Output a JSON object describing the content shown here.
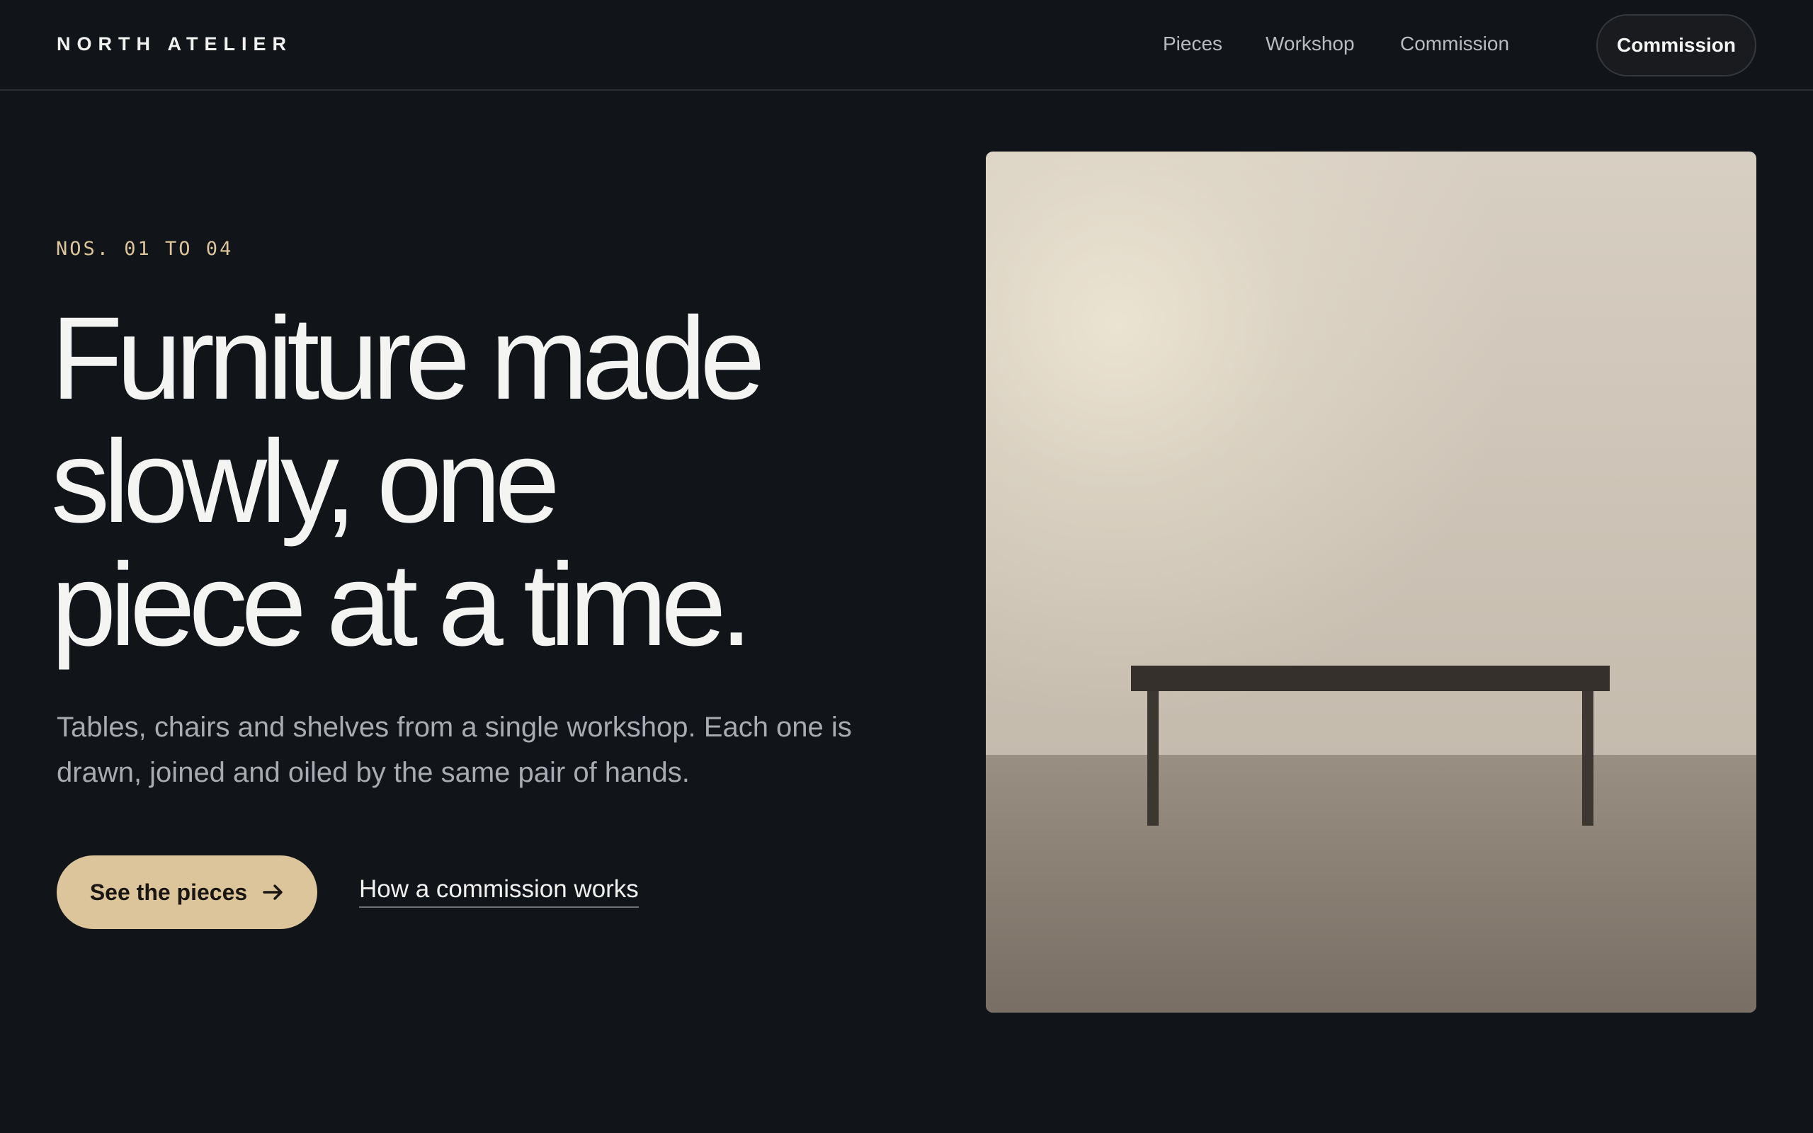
{
  "header": {
    "brand": "NORTH ATELIER",
    "nav": [
      "Pieces",
      "Workshop",
      "Commission"
    ],
    "cta_label": "Commission"
  },
  "hero": {
    "eyebrow": "NOS. 01 TO 04",
    "headline_lines": [
      "Furniture made",
      "slowly, one",
      "piece at a time."
    ],
    "lede": "Tables, chairs and shelves from a single workshop. Each one is drawn, joined and oiled by the same pair of hands.",
    "primary_button": "See the pieces",
    "primary_icon": "arrow-right-icon",
    "secondary_link": "How a commission works"
  },
  "colors": {
    "background": "#111419",
    "accent": "#dcc49b",
    "text": "#f4f4f2",
    "muted_text": "#a8acb0"
  }
}
